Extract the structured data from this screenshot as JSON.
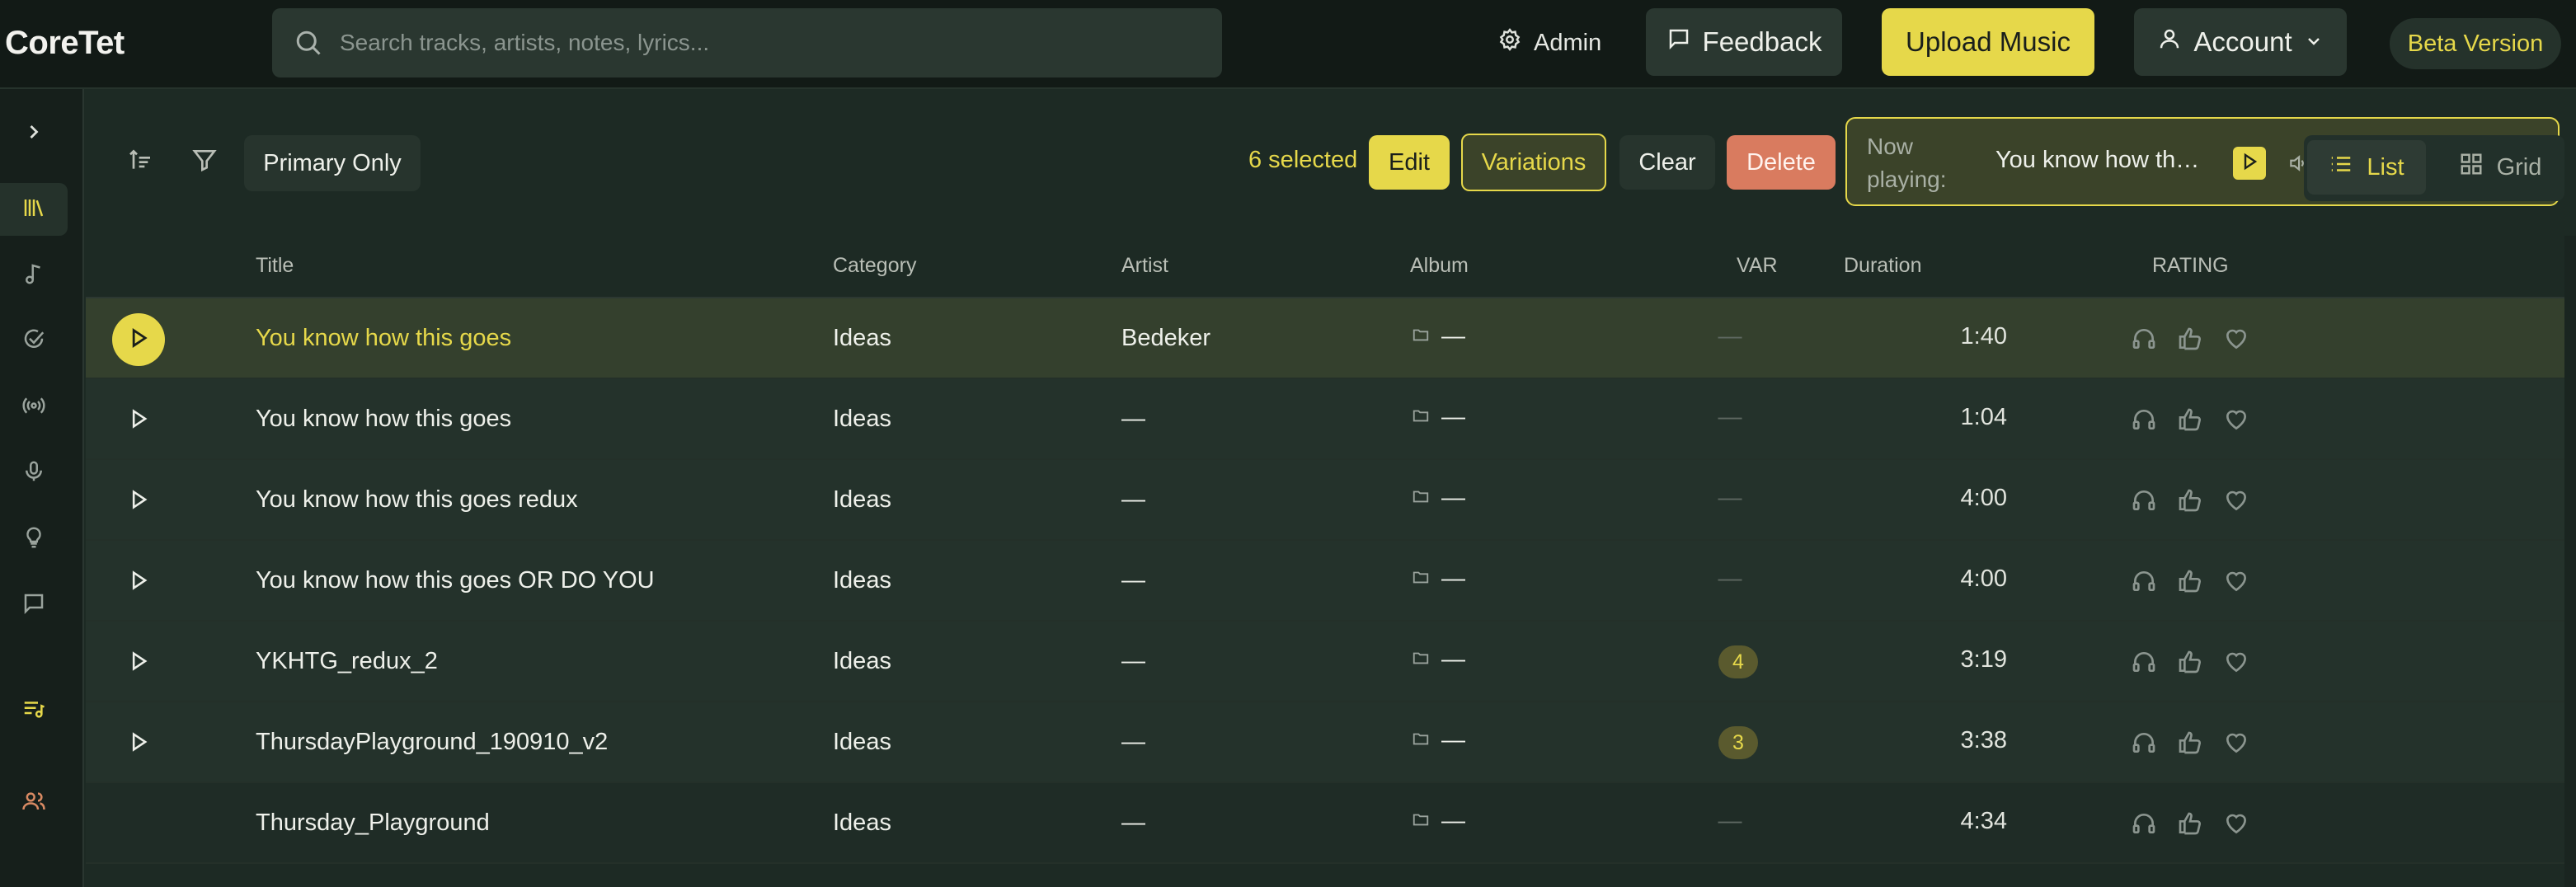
{
  "header": {
    "logo": "CoreTet",
    "search_placeholder": "Search tracks, artists, notes, lyrics...",
    "admin_label": "Admin",
    "feedback_label": "Feedback",
    "upload_label": "Upload Music",
    "account_label": "Account",
    "beta_label": "Beta Version"
  },
  "sidebar": {
    "items": [
      {
        "icon": "chevron-right-icon"
      },
      {
        "icon": "library-icon",
        "active": true
      },
      {
        "icon": "music-note-icon"
      },
      {
        "icon": "check-circle-icon"
      },
      {
        "icon": "broadcast-icon"
      },
      {
        "icon": "microphone-icon"
      },
      {
        "icon": "lightbulb-icon"
      },
      {
        "icon": "chat-icon"
      },
      {
        "icon": "playlist-icon"
      },
      {
        "icon": "users-icon"
      }
    ]
  },
  "toolbar": {
    "primary_only_label": "Primary Only",
    "selected_text": "6 selected",
    "edit_label": "Edit",
    "variations_label": "Variations",
    "clear_label": "Clear",
    "delete_label": "Delete",
    "now_playing_label": "Now playing:",
    "now_playing_title": "You know how this goes",
    "view_list_label": "List",
    "view_grid_label": "Grid"
  },
  "table": {
    "headers": {
      "title": "Title",
      "category": "Category",
      "artist": "Artist",
      "album": "Album",
      "var": "VAR",
      "duration": "Duration",
      "rating": "RATING"
    },
    "rows": [
      {
        "title": "You know how this goes",
        "category": "Ideas",
        "artist": "Bedeker",
        "album": "—",
        "var": "—",
        "duration": "1:40"
      },
      {
        "title": "You know how this goes",
        "category": "Ideas",
        "artist": "—",
        "album": "—",
        "var": "—",
        "duration": "1:04"
      },
      {
        "title": "You know how this goes redux",
        "category": "Ideas",
        "artist": "—",
        "album": "—",
        "var": "—",
        "duration": "4:00"
      },
      {
        "title": "You know how this goes OR DO YOU",
        "category": "Ideas",
        "artist": "—",
        "album": "—",
        "var": "—",
        "duration": "4:00"
      },
      {
        "title": "YKHTG_redux_2",
        "category": "Ideas",
        "artist": "—",
        "album": "—",
        "var": "4",
        "duration": "3:19"
      },
      {
        "title": "ThursdayPlayground_190910_v2",
        "category": "Ideas",
        "artist": "—",
        "album": "—",
        "var": "3",
        "duration": "3:38"
      },
      {
        "title": "Thursday_Playground",
        "category": "Ideas",
        "artist": "—",
        "album": "—",
        "var": "—",
        "duration": "4:34"
      }
    ]
  },
  "colors": {
    "accent": "#e6d84a",
    "danger": "#d97b5f",
    "background": "#1d2a24",
    "header_bg": "#121a16"
  }
}
